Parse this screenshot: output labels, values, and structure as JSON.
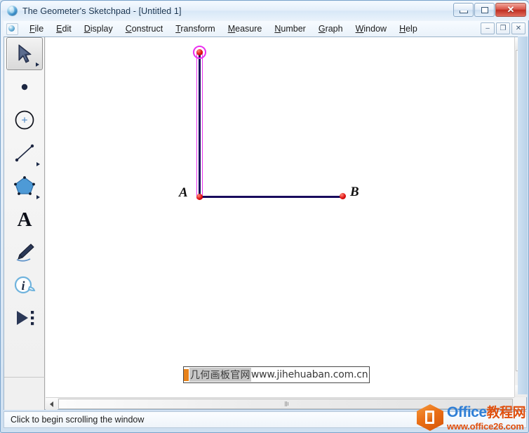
{
  "window": {
    "title": "The Geometer's Sketchpad - [Untitled 1]",
    "app_icon": "sketchpad-globe-icon",
    "buttons": {
      "minimize": "minimize-icon",
      "maximize": "maximize-icon",
      "close": "✕"
    }
  },
  "menu": {
    "doc_icon": "document-globe-icon",
    "items": [
      {
        "accel": "F",
        "rest": "ile"
      },
      {
        "accel": "E",
        "rest": "dit"
      },
      {
        "accel": "D",
        "rest": "isplay"
      },
      {
        "accel": "C",
        "rest": "onstruct"
      },
      {
        "accel": "T",
        "rest": "ransform"
      },
      {
        "accel": "M",
        "rest": "easure"
      },
      {
        "accel": "N",
        "rest": "umber"
      },
      {
        "accel": "G",
        "rest": "raph"
      },
      {
        "accel": "W",
        "rest": "indow"
      },
      {
        "accel": "H",
        "rest": "elp"
      }
    ],
    "doc_buttons": {
      "minimize": "–",
      "restore": "❐",
      "close": "✕"
    }
  },
  "toolbar": {
    "tools": [
      {
        "name": "arrow-select-tool",
        "selected": true,
        "has_flyout": true
      },
      {
        "name": "point-tool",
        "selected": false,
        "has_flyout": false
      },
      {
        "name": "compass-circle-tool",
        "selected": false,
        "has_flyout": false
      },
      {
        "name": "straightedge-segment-tool",
        "selected": false,
        "has_flyout": true
      },
      {
        "name": "polygon-tool",
        "selected": false,
        "has_flyout": true
      },
      {
        "name": "text-tool",
        "selected": false,
        "has_flyout": false
      },
      {
        "name": "marker-pen-tool",
        "selected": false,
        "has_flyout": false
      },
      {
        "name": "information-tool",
        "selected": false,
        "has_flyout": false
      },
      {
        "name": "custom-tool",
        "selected": false,
        "has_flyout": false
      }
    ]
  },
  "canvas": {
    "labels": {
      "point_a": "A",
      "point_b": "B"
    },
    "colors": {
      "segment": "#18095c",
      "point": "#d61111",
      "selection": "#ea2ff0"
    },
    "geometry": {
      "vertical_segment_selected": true,
      "top_point_selected": true
    },
    "watermark_textbox": {
      "chinese": "几何画板官网",
      "url": "www.jihehuaban.com.cn",
      "accent_color": "#e8821a"
    }
  },
  "scrollbars": {
    "vertical": {
      "up": "scroll-up-arrow",
      "down": "scroll-down-arrow"
    },
    "horizontal": {
      "left": "scroll-left-arrow",
      "right": "scroll-right-arrow"
    }
  },
  "status": {
    "message": "Click to begin scrolling the window"
  },
  "office_watermark": {
    "brand_en": "Office",
    "brand_cn": "教程网",
    "url": "www.office26.com",
    "brand_color": "#2f7fd6",
    "accent_color": "#e0500e"
  }
}
